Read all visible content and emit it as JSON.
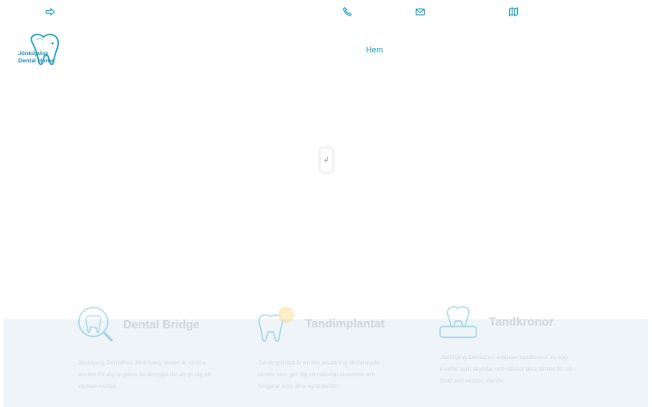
{
  "topbar": {
    "icons": [
      "login-arrow-icon",
      "phone-icon",
      "mail-icon",
      "map-icon"
    ]
  },
  "logo": {
    "line1": "Jönköping",
    "line2": "Dental Home"
  },
  "nav": {
    "home_label": "Hem"
  },
  "slider": {
    "handle_glyph": "↲"
  },
  "services": {
    "items": [
      {
        "icon": "tooth-search-icon",
        "title": "Dental Bridge",
        "text": "Jönköping Dentalhus Jönköping tänder är vackra ansikte för dig ungdom tandbrygga för att ge dig ett vackert leende."
      },
      {
        "icon": "tooth-implant-icon",
        "title": "Tandimplantat",
        "text": "Tandimplantat är en bra ersättning till förlorade tänder som ger dig ett naturligt utseende och fungerar som dina egna tänder."
      },
      {
        "icon": "tooth-crown-icon",
        "title": "Tandkronor",
        "text": "Jönköping Dentalhus erbjuder tandkronor av hög kvalitet som skyddar och stärker dina tänder för ett friskt och vackert leende."
      }
    ],
    "colors": {
      "accent": "#1ba3c6",
      "band": "#eef4f8"
    }
  }
}
